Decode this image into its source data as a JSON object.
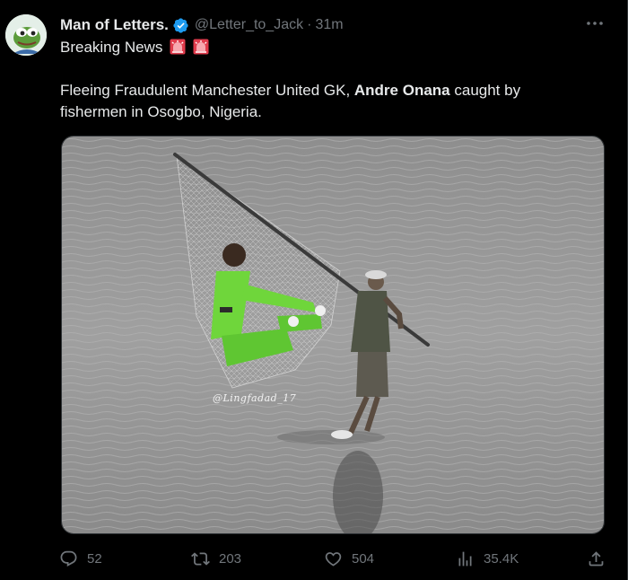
{
  "author": {
    "display_name": "Man of Letters.",
    "handle": "@Letter_to_Jack",
    "separator": "·",
    "timestamp": "31m",
    "verified_color": "#1d9bf0"
  },
  "tweet": {
    "line1": "Breaking News",
    "line2_prefix": "Fleeing Fraudulent Manchester United GK, ",
    "line2_bold": "Andre Onana",
    "line2_suffix": " caught by fishermen in Osogbo, Nigeria."
  },
  "media": {
    "description_icon": "photo",
    "watermark": "@Lingfadad_17"
  },
  "actions": {
    "replies": "52",
    "retweets": "203",
    "likes": "504",
    "views": "35.4K"
  },
  "colors": {
    "background": "#000000",
    "text": "#e7e9ea",
    "muted": "#71767b",
    "accent": "#1d9bf0"
  }
}
